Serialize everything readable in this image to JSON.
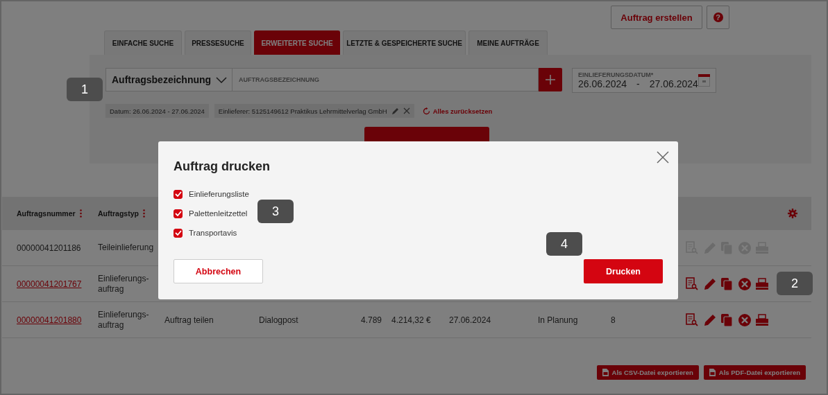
{
  "header": {
    "create_button": "Auftrag erstellen",
    "help": "?"
  },
  "tabs": [
    {
      "label": "EINFACHE SUCHE",
      "selected": false
    },
    {
      "label": "PRESSESUCHE",
      "selected": false
    },
    {
      "label": "ERWEITERTE SUCHE",
      "selected": true
    },
    {
      "label": "LETZTE & GESPEICHERTE SUCHE",
      "selected": false
    },
    {
      "label": "MEINE AUFTRÄGE",
      "selected": false
    }
  ],
  "search": {
    "field_select": "Auftragsbezeichnung",
    "placeholder": "AUFTRAGSBEZEICHNUNG",
    "date": {
      "label": "EINLIEFERUNGSDATUM*",
      "from": "26.06.2024",
      "separator": "-",
      "to": "27.06.2024"
    }
  },
  "filters": [
    {
      "text": "Datum: 26.06.2024 - 27.06.2024",
      "editable": false
    },
    {
      "text": "Einlieferer: 5125149612 Praktikus Lehrmittelverlag GmbH",
      "editable": true
    }
  ],
  "reset": "Alles zurücksetzen",
  "update_button": {
    "kind": "covered"
  },
  "table": {
    "columns": [
      {
        "label": "Auftragsnummer",
        "menu": true
      },
      {
        "label": "Auftragstyp",
        "menu": true
      }
    ],
    "rows": [
      {
        "link": false,
        "actions_disabled": true,
        "cells": [
          "00000041201186",
          "Teileinlieferung"
        ]
      },
      {
        "link": true,
        "actions_disabled": false,
        "cells": [
          "00000041201767",
          "Einlieferungs-auftrag"
        ]
      },
      {
        "link": true,
        "actions_disabled": false,
        "cells": [
          "00000041201880",
          "Einlieferungs-auftrag",
          "Auftrag teilen",
          "Dialogpost",
          "4.789",
          "4.214,32 €",
          "27.06.2024",
          "In Planung",
          "8"
        ]
      }
    ]
  },
  "exports": [
    "Als CSV-Datei exportieren",
    "Als PDF-Datei exportieren"
  ],
  "dialog": {
    "title": "Auftrag drucken",
    "options": [
      {
        "label": "Einlieferungsliste",
        "checked": true
      },
      {
        "label": "Palettenleitzettel",
        "checked": true
      },
      {
        "label": "Transportavis",
        "checked": true
      }
    ],
    "cancel": "Abbrechen",
    "confirm": "Drucken"
  },
  "callouts": [
    "1",
    "2",
    "3",
    "4"
  ]
}
